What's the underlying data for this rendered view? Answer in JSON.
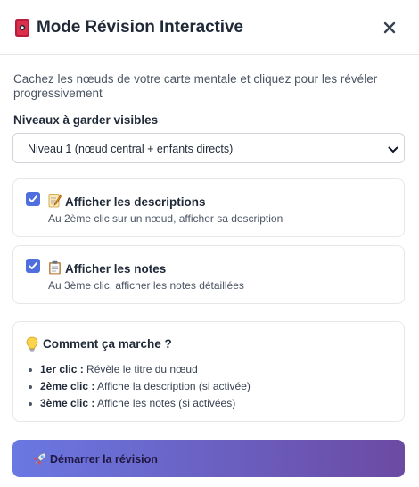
{
  "header": {
    "title": "Mode Révision Interactive",
    "title_icon": "red-card-icon",
    "close_icon": "close-icon"
  },
  "intro": {
    "text": "Cachez les nœuds de votre carte mentale et cliquez pour les révéler progressivement"
  },
  "levels": {
    "label": "Niveaux à garder visibles",
    "selected": "Niveau 1 (nœud central + enfants directs)"
  },
  "options": [
    {
      "icon": "memo-icon",
      "checked": true,
      "title": "Afficher les descriptions",
      "subtitle": "Au 2ème clic sur un nœud, afficher sa description"
    },
    {
      "icon": "clipboard-icon",
      "checked": true,
      "title": "Afficher les notes",
      "subtitle": "Au 3ème clic, afficher les notes détaillées"
    }
  ],
  "how_it_works": {
    "icon": "lightbulb-icon",
    "title": "Comment ça marche ?",
    "items": [
      {
        "label": "1er clic :",
        "text": "Révèle le titre du nœud"
      },
      {
        "label": "2ème clic :",
        "text": "Affiche la description (si activée)"
      },
      {
        "label": "3ème clic :",
        "text": "Affiche les notes (si activées)"
      }
    ]
  },
  "start_button": {
    "icon": "rocket-icon",
    "label": "Démarrer la révision"
  },
  "colors": {
    "accent": "#4f6fde",
    "button_gradient_start": "#6a78e2",
    "button_gradient_end": "#6b4aa3"
  }
}
